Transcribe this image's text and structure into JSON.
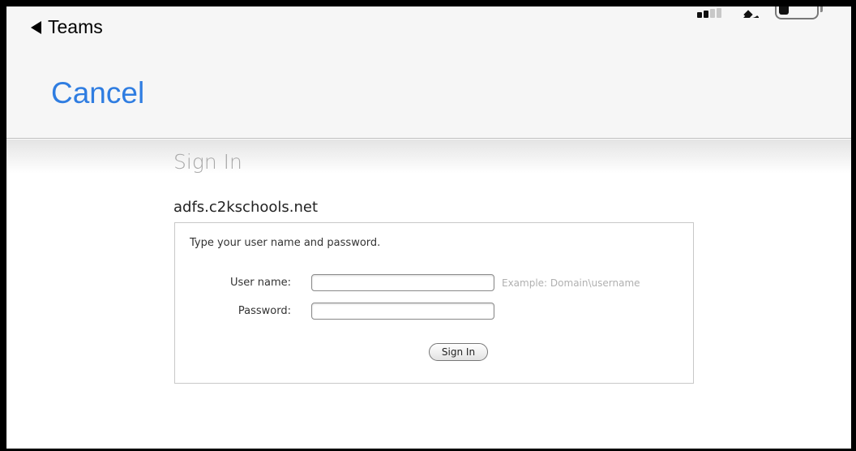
{
  "nav": {
    "back_label": "Teams",
    "cancel_label": "Cancel"
  },
  "status_bar": {
    "signal_bars_on": 2,
    "signal_bars_total": 4,
    "battery_level": 0.25
  },
  "page": {
    "title": "Sign In",
    "domain": "adfs.c2kschools.net"
  },
  "form": {
    "instructions": "Type your user name and password.",
    "username_label": "User name:",
    "username_value": "",
    "username_hint": "Example: Domain\\username",
    "password_label": "Password:",
    "password_value": "",
    "submit_label": "Sign In"
  },
  "colors": {
    "accent": "#2f7de1",
    "title_gray": "#a8a8a8"
  },
  "icons": {
    "back": "back-triangle-icon",
    "signal": "cellular-signal-icon",
    "wifi": "wifi-icon",
    "battery": "battery-icon"
  }
}
